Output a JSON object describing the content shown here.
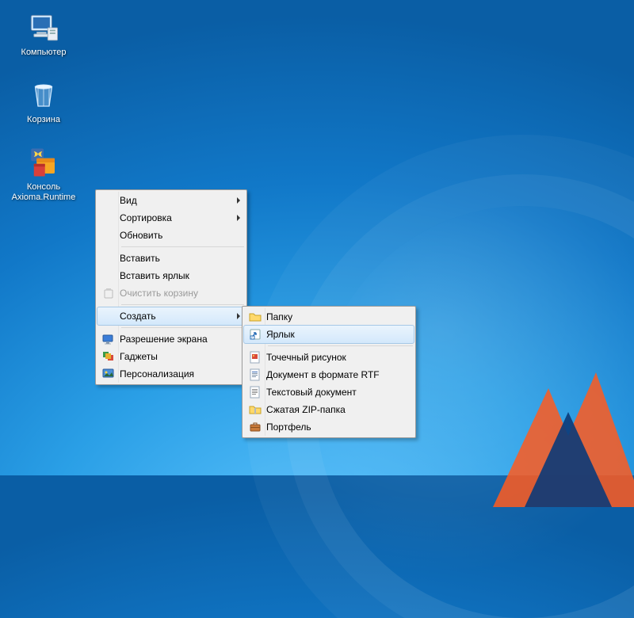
{
  "desktop": {
    "icons": [
      {
        "name": "computer",
        "label": "Компьютер"
      },
      {
        "name": "recyclebin",
        "label": "Корзина"
      },
      {
        "name": "console",
        "label": "Консоль Axioma.Runtime"
      }
    ]
  },
  "contextMenu": {
    "items": [
      {
        "label": "Вид",
        "submenu": true
      },
      {
        "label": "Сортировка",
        "submenu": true
      },
      {
        "label": "Обновить"
      },
      {
        "sep": true
      },
      {
        "label": "Вставить"
      },
      {
        "label": "Вставить ярлык"
      },
      {
        "label": "Очистить корзину",
        "disabled": true,
        "icon": "trash"
      },
      {
        "sep": true
      },
      {
        "label": "Создать",
        "submenu": true,
        "hover": true
      },
      {
        "sep": true
      },
      {
        "label": "Разрешение экрана",
        "icon": "display"
      },
      {
        "label": "Гаджеты",
        "icon": "gadgets"
      },
      {
        "label": "Персонализация",
        "icon": "personalize"
      }
    ]
  },
  "createSubmenu": {
    "items": [
      {
        "label": "Папку",
        "icon": "folder"
      },
      {
        "label": "Ярлык",
        "icon": "shortcut",
        "hover": true
      },
      {
        "sep": true
      },
      {
        "label": "Точечный рисунок",
        "icon": "bmp"
      },
      {
        "label": "Документ в формате RTF",
        "icon": "rtf"
      },
      {
        "label": "Текстовый документ",
        "icon": "txt"
      },
      {
        "label": "Сжатая ZIP-папка",
        "icon": "zip"
      },
      {
        "label": "Портфель",
        "icon": "briefcase"
      }
    ]
  }
}
